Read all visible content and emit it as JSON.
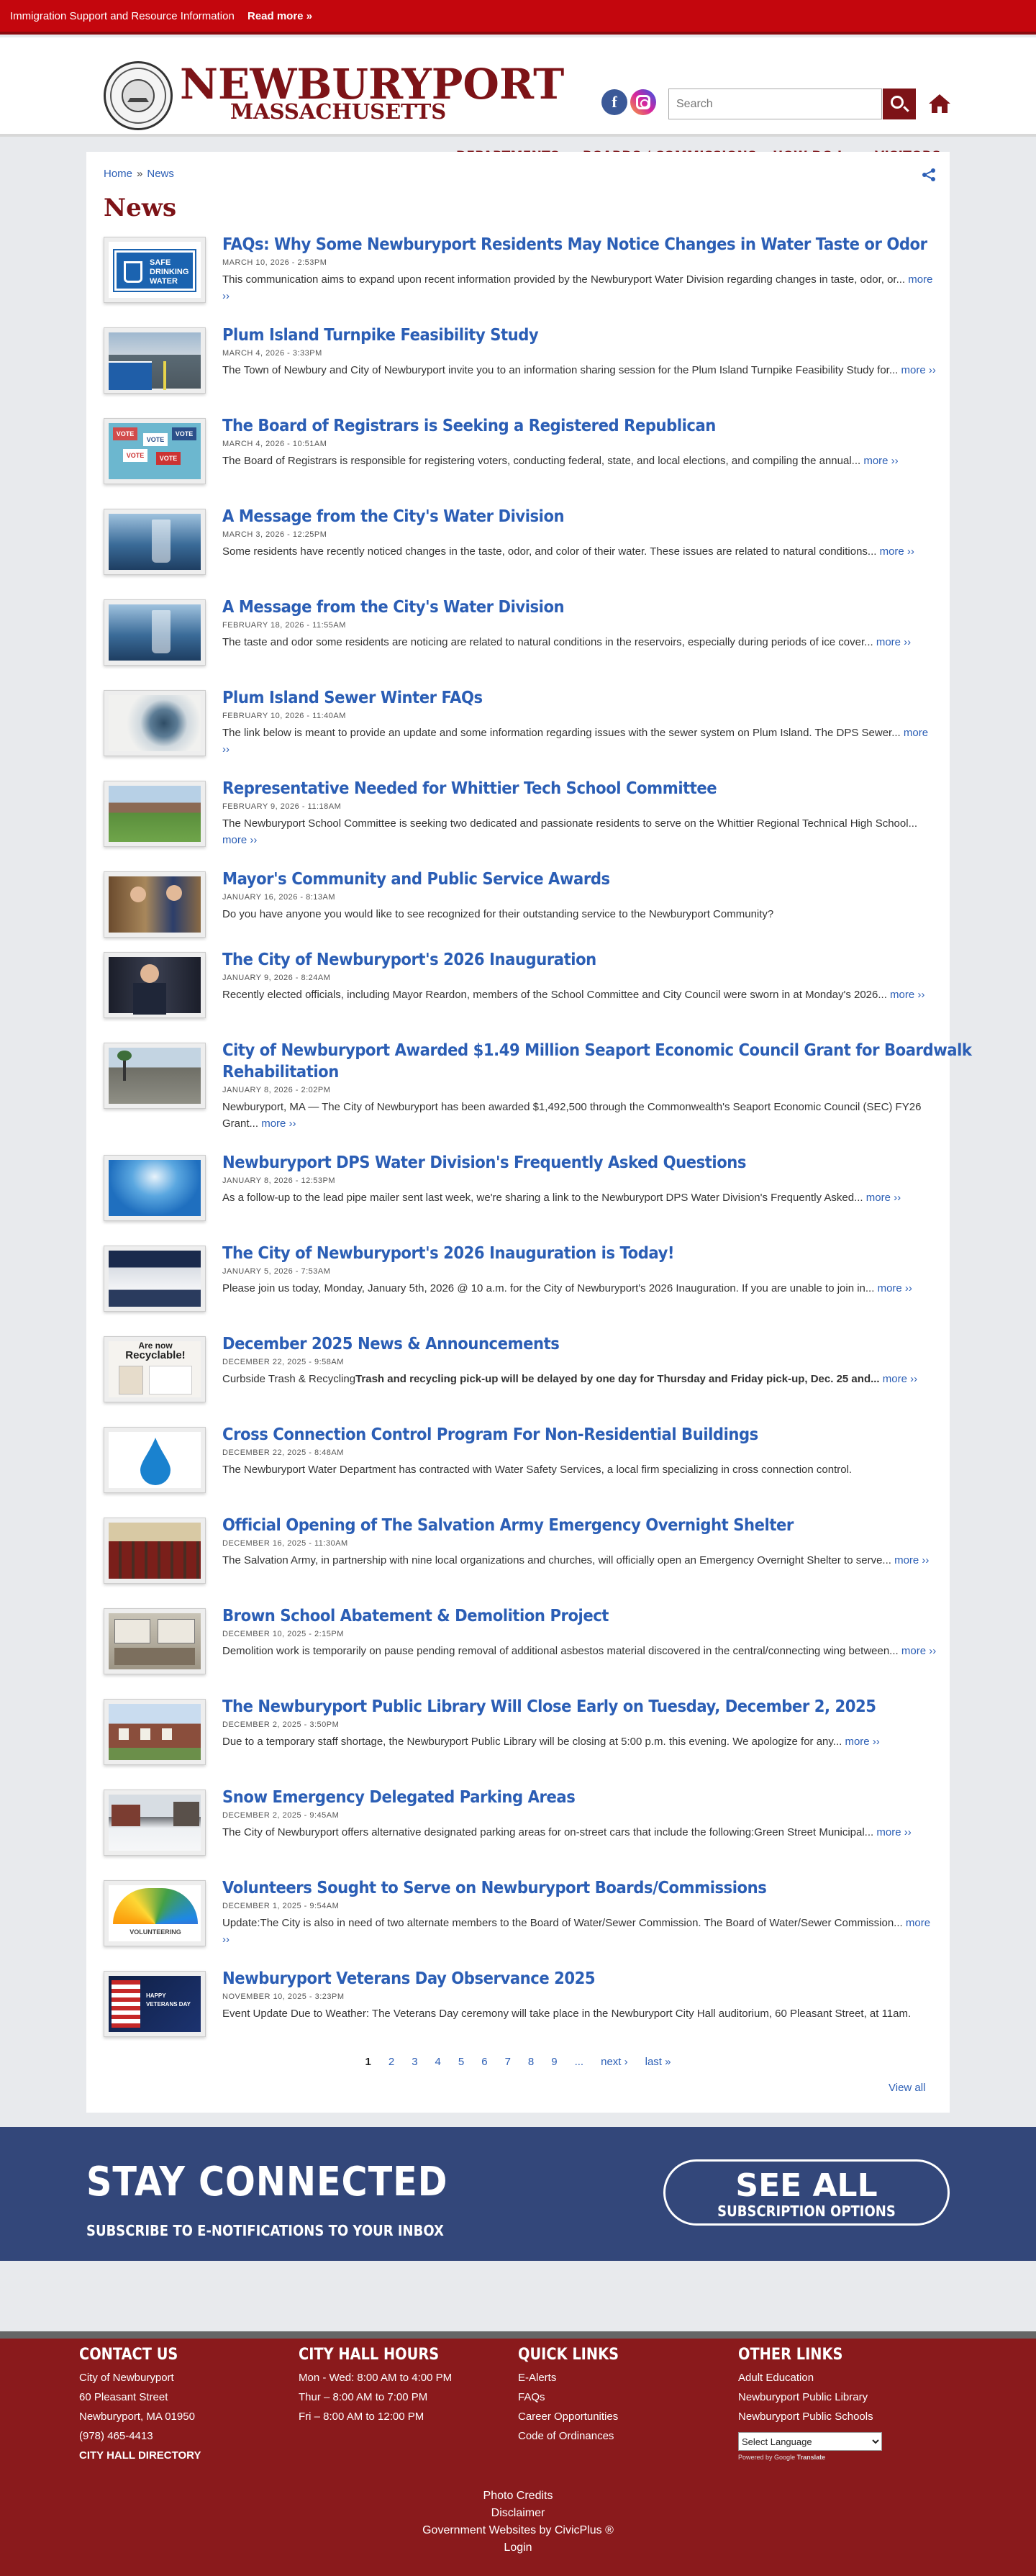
{
  "alert": {
    "text": "Immigration Support and Resource Information",
    "link": "Read more »"
  },
  "header": {
    "logo_line1": "NEWBURYPORT",
    "logo_line2": "MASSACHUSETTS",
    "search_placeholder": "Search",
    "nav": [
      "DEPARTMENTS",
      "BOARDS / COMMISSIONS",
      "HOW DO I...",
      "VISITORS"
    ],
    "icons": [
      "facebook-icon",
      "instagram-icon",
      "search-icon",
      "home-icon"
    ],
    "accent_color": "#7d1317"
  },
  "breadcrumb": {
    "home": "Home",
    "sep": "»",
    "current": "News"
  },
  "page_title": "News",
  "news": [
    {
      "title": "FAQs: Why Some Newburyport Residents May Notice Changes in Water Taste or Odor",
      "date": "MARCH 10, 2026 - 2:53PM",
      "desc": "This communication aims to expand upon recent information provided by the Newburyport Water Division regarding changes in taste, odor, or...",
      "more": "more ››"
    },
    {
      "title": "Plum Island Turnpike Feasibility Study",
      "date": "MARCH 4, 2026 - 3:33PM",
      "desc": "The Town of Newbury and City of Newburyport invite you to an information sharing session for the Plum Island Turnpike Feasibility Study for...",
      "more": "more ››"
    },
    {
      "title": "The Board of Registrars is Seeking a Registered Republican",
      "date": "MARCH 4, 2026 - 10:51AM",
      "desc": "The Board of Registrars is responsible for registering voters, conducting federal, state, and local elections, and compiling the annual...",
      "more": "more ››"
    },
    {
      "title": "A Message from the City's Water Division",
      "date": "MARCH 3, 2026 - 12:25PM",
      "desc": "Some residents have recently noticed changes in the taste, odor, and color of their water. These issues are related to natural conditions...",
      "more": "more ››"
    },
    {
      "title": "A Message from the City's Water Division",
      "date": "FEBRUARY 18, 2026 - 11:55AM",
      "desc": "The taste and odor some residents are noticing are related to natural conditions in the reservoirs, especially during periods of ice cover...",
      "more": "more ››"
    },
    {
      "title": "Plum Island Sewer Winter FAQs",
      "date": "FEBRUARY 10, 2026 - 11:40AM",
      "desc": "The link below is meant to provide an update and some information regarding issues with the sewer system on Plum Island. The DPS Sewer...",
      "more": "more ››"
    },
    {
      "title": "Representative Needed for Whittier Tech School Committee",
      "date": "FEBRUARY 9, 2026 - 11:18AM",
      "desc": "The Newburyport School Committee is seeking two dedicated and passionate residents to serve on the Whittier Regional Technical High School...",
      "more": "more ››"
    },
    {
      "title": "Mayor's Community and Public Service Awards",
      "date": "JANUARY 16, 2026 - 8:13AM",
      "desc": "Do you have anyone you would like to see recognized for their outstanding service to the Newburyport Community?",
      "more": ""
    },
    {
      "title": "The City of Newburyport's 2026 Inauguration",
      "date": "JANUARY 9, 2026 - 8:24AM",
      "desc": "Recently elected officials, including Mayor Reardon, members of the School Committee and City Council were sworn in at Monday's 2026...",
      "more": "more ››"
    },
    {
      "title": "City of Newburyport Awarded $1.49 Million Seaport Economic Council Grant for Boardwalk",
      "title2": "Rehabilitation",
      "date": "JANUARY 8, 2026 - 2:02PM",
      "desc": "Newburyport, MA — The City of Newburyport has been awarded $1,492,500 through the Commonwealth's Seaport Economic Council (SEC) FY26 Grant...",
      "more": "more ››"
    },
    {
      "title": "Newburyport DPS Water Division's Frequently Asked Questions",
      "date": "JANUARY 8, 2026 - 12:53PM",
      "desc": "As a follow-up to the lead pipe mailer sent last week, we're sharing a link to the Newburyport DPS Water Division's Frequently Asked...",
      "more": "more ››"
    },
    {
      "title": "The City of Newburyport's 2026 Inauguration is Today!",
      "date": "JANUARY 5, 2026 - 7:53AM",
      "desc": "Please join us today, Monday, January 5th, 2026 @ 10 a.m. for the City of Newburyport's 2026 Inauguration. If you are unable to join in...",
      "more": "more ››"
    },
    {
      "title": "December 2025 News & Announcements",
      "date": "DECEMBER 22, 2025 - 9:58AM",
      "desc": "Curbside Trash & Recycling",
      "desc_bold": "Trash and recycling pick-up will be delayed by one day for Thursday and Friday pick-up, Dec. 25 and...",
      "more": "more ››"
    },
    {
      "title": "Cross Connection Control Program For Non-Residential Buildings",
      "date": "DECEMBER 22, 2025 - 8:48AM",
      "desc": "The Newburyport Water Department has contracted with Water Safety Services, a local firm specializing in cross connection control.",
      "more": ""
    },
    {
      "title": "Official Opening of The Salvation Army Emergency Overnight Shelter",
      "date": "DECEMBER 16, 2025 - 11:30AM",
      "desc": "The Salvation Army, in partnership with nine local organizations and churches, will officially open an Emergency Overnight Shelter to serve...",
      "more": "more ››"
    },
    {
      "title": "Brown School Abatement & Demolition Project",
      "date": "DECEMBER 10, 2025 - 2:15PM",
      "desc": "Demolition work is temporarily on pause pending removal of additional asbestos material discovered in the central/connecting wing between...",
      "more": "more ››"
    },
    {
      "title": "The Newburyport Public Library Will Close Early on Tuesday, December 2, 2025",
      "date": "DECEMBER 2, 2025 - 3:50PM",
      "desc": "Due to a temporary staff shortage, the Newburyport Public Library will be closing at 5:00 p.m. this evening. We apologize for any...",
      "more": "more ››"
    },
    {
      "title": "Snow Emergency Delegated Parking Areas",
      "date": "DECEMBER 2, 2025 - 9:45AM",
      "desc": "The City of Newburyport offers alternative designated parking areas for on-street cars that include the following:Green Street Municipal...",
      "more": "more ››"
    },
    {
      "title": "Volunteers Sought to Serve on Newburyport Boards/Commissions",
      "date": "DECEMBER 1, 2025 - 9:54AM",
      "desc": "Update:The City is also in need of two alternate members to the Board of Water/Sewer Commission. The Board of Water/Sewer Commission...",
      "more": "more ››"
    },
    {
      "title": "Newburyport Veterans Day Observance 2025",
      "date": "NOVEMBER 10, 2025 - 3:23PM",
      "desc": "Event Update Due to Weather: The Veterans Day ceremony will take place in the Newburyport City Hall auditorium, 60 Pleasant Street, at 11am.",
      "more": ""
    }
  ],
  "thumb_text": {
    "water_sign1": "SAFE",
    "water_sign2": "DRINKING",
    "water_sign3": "WATER",
    "vote": "VOTE",
    "recycle1": "Are now",
    "recycle2": "Recyclable!",
    "volunteer": "VOLUNTEERING",
    "veterans1": "HAPPY",
    "veterans2": "VETERANS DAY"
  },
  "pager": {
    "pages": [
      "1",
      "2",
      "3",
      "4",
      "5",
      "6",
      "7",
      "8",
      "9"
    ],
    "ellipsis": "...",
    "next": "next ›",
    "last": "last »",
    "view_all": "View all"
  },
  "stay": {
    "title": "STAY CONNECTED",
    "subtitle": "SUBSCRIBE TO E-NOTIFICATIONS TO YOUR INBOX",
    "btn1": "SEE ALL",
    "btn2": "SUBSCRIPTION OPTIONS"
  },
  "footer": {
    "contact": {
      "title": "CONTACT US",
      "lines": [
        "City of Newburyport",
        "60 Pleasant Street",
        "Newburyport, MA 01950",
        "(978) 465-4413"
      ],
      "directory": "CITY HALL DIRECTORY"
    },
    "hours": {
      "title": "CITY HALL HOURS",
      "lines": [
        "Mon - Wed: 8:00 AM to 4:00 PM",
        "Thur – 8:00 AM to 7:00 PM",
        "Fri – 8:00 AM to 12:00 PM"
      ]
    },
    "quick": {
      "title": "QUICK LINKS",
      "lines": [
        "E-Alerts",
        "FAQs",
        "Career Opportunities",
        "Code of Ordinances"
      ]
    },
    "other": {
      "title": "OTHER LINKS",
      "lines": [
        "Adult Education",
        "Newburyport Public Library",
        "Newburyport Public Schools"
      ],
      "lang": "Select Language",
      "powered": "Powered by",
      "google": "Google",
      "translate": "Translate"
    },
    "bottom": [
      "Photo Credits",
      "Disclaimer",
      "Government Websites by CivicPlus ®",
      "Login"
    ]
  }
}
